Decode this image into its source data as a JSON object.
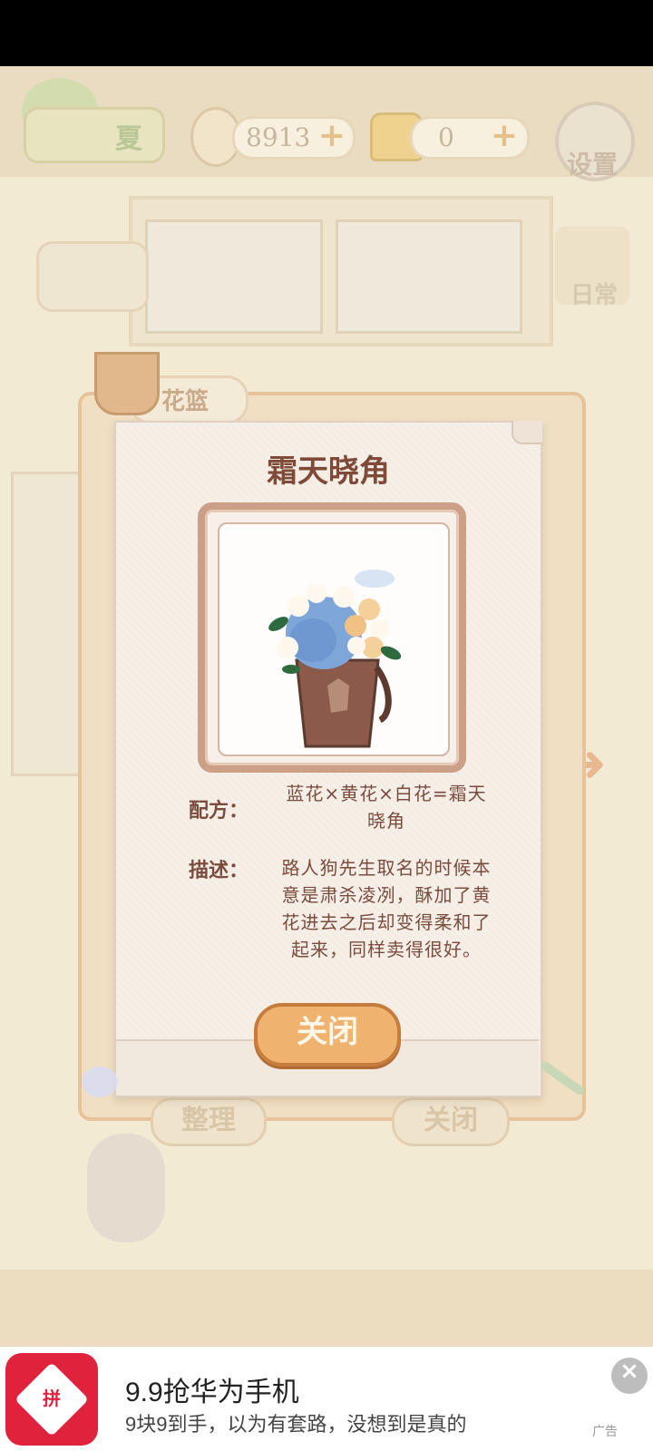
{
  "top_bar": {
    "season": "夏",
    "fish_count": "8913",
    "cheese_count": "0",
    "plus_label": "+",
    "settings_label": "设置",
    "daily_label": "日常"
  },
  "background": {
    "basket_label": "花篮",
    "organize_label": "整理",
    "close_label": "关闭"
  },
  "dialog": {
    "title": "霜天晓角",
    "formula_label": "配方：",
    "formula_value": "蓝花×黄花×白花=霜天晓角",
    "description_label": "描述：",
    "description_value": "路人狗先生取名的时候本意是肃杀凌冽，酥加了黄花进去之后却变得柔和了起来，同样卖得很好。",
    "close_button": "关闭",
    "image_icon": "bouquet-icon"
  },
  "ad": {
    "title": "9.9抢华为手机",
    "subtitle": "9块9到手，以为有套路，没想到是真的",
    "tag": "广告",
    "logo_text": "拼",
    "close_icon": "close-icon",
    "accent": "#e0223d"
  },
  "colors": {
    "button_fill": "#f0b36f",
    "button_border": "#c67c3d",
    "text_brown": "#7a4c3d"
  }
}
